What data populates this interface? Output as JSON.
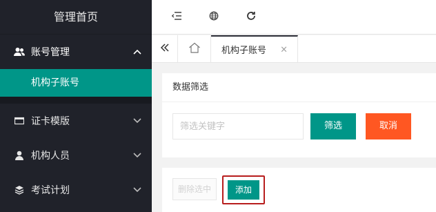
{
  "sidebar": {
    "logo": "管理首页",
    "items": [
      {
        "label": "账号管理",
        "icon": "users-icon",
        "expanded": true,
        "children": [
          {
            "label": "机构子账号",
            "active": true
          }
        ]
      },
      {
        "label": "证卡模版",
        "icon": "card-icon",
        "expanded": false
      },
      {
        "label": "机构人员",
        "icon": "user-icon",
        "expanded": false
      },
      {
        "label": "考试计划",
        "icon": "layers-icon",
        "expanded": false
      }
    ]
  },
  "header": {
    "buttons": [
      "menu-toggle-icon",
      "globe-icon",
      "refresh-icon"
    ]
  },
  "tabs": {
    "active_label": "机构子账号",
    "close_glyph": "×"
  },
  "filter_card": {
    "title": "数据筛选",
    "input_placeholder": "筛选关键字",
    "input_value": "",
    "filter_button": "筛选",
    "cancel_button": "取消"
  },
  "action_card": {
    "delete_button": "删除选中",
    "add_button": "添加"
  },
  "colors": {
    "sidebar_bg": "#20222a",
    "accent_green": "#009688",
    "accent_orange": "#ff5722",
    "highlight_frame": "#b71c1c"
  }
}
